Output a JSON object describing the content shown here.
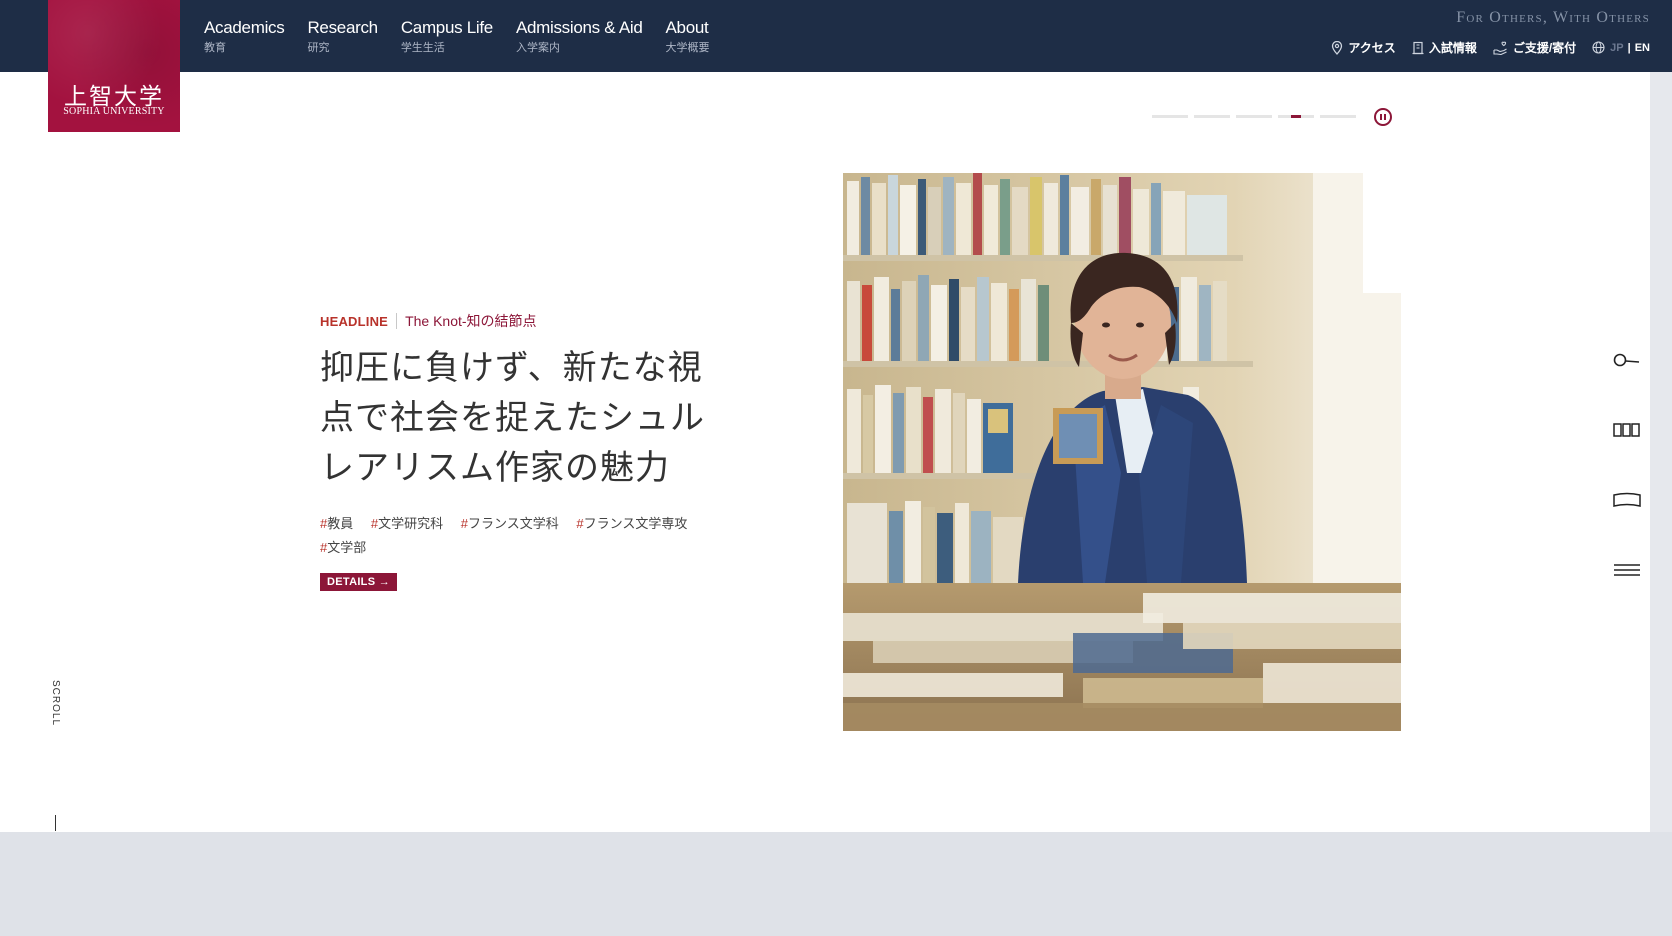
{
  "brand": {
    "logo_jp": "上智大学",
    "logo_en": "SOPHIA UNIVERSITY",
    "tagline": "For Others, With Others",
    "colors": {
      "navy": "#1e2d46",
      "maroon": "#8c1638",
      "logo": "#a3123f",
      "tag_red": "#b8322a"
    }
  },
  "nav": {
    "items": [
      {
        "en": "Academics",
        "jp": "教育"
      },
      {
        "en": "Research",
        "jp": "研究"
      },
      {
        "en": "Campus Life",
        "jp": "学生生活"
      },
      {
        "en": "Admissions & Aid",
        "jp": "入学案内"
      },
      {
        "en": "About",
        "jp": "大学概要"
      }
    ]
  },
  "utility": {
    "access": "アクセス",
    "admissions_info": "入試情報",
    "support": "ご支援/寄付",
    "lang_jp": "JP",
    "lang_sep": "|",
    "lang_en": "EN",
    "icons": [
      "location-pin-icon",
      "building-icon",
      "hand-heart-icon",
      "globe-icon"
    ]
  },
  "slider": {
    "total": 5,
    "active_index": 3
  },
  "hero": {
    "headline_tag": "HEADLINE",
    "series": "The Knot-知の結節点",
    "title": "抑圧に負けず、新たな視点で社会を捉えたシュルレアリスム作家の魅力",
    "tags": [
      "教員",
      "文学研究科",
      "フランス文学科",
      "フランス文学専攻",
      "文学部"
    ],
    "tag_prefix": "#",
    "details": "DETAILS →"
  },
  "scroll": {
    "label": "SCROLL"
  },
  "side_icons": [
    "search-icon",
    "books-icon",
    "open-book-icon",
    "menu-icon"
  ]
}
